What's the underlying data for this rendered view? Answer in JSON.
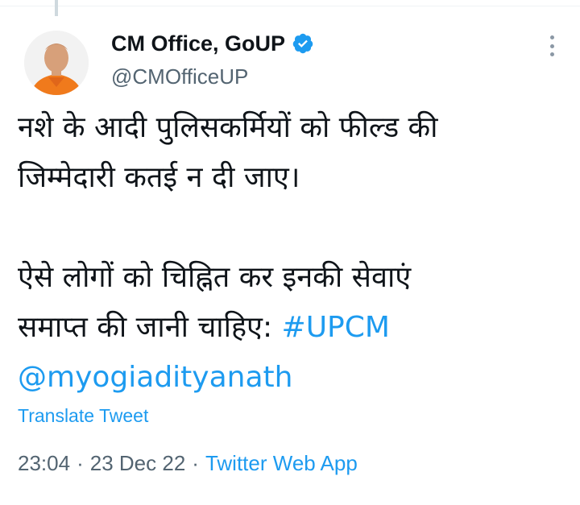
{
  "tweet": {
    "author": {
      "display_name": "CM Office, GoUP",
      "handle": "@CMOfficeUP",
      "verified": true
    },
    "text_lines": [
      "नशे के आदी पुलिसकर्मियों को फील्ड की",
      "जिम्मेदारी कतई न दी जाए।",
      "",
      "ऐसे लोगों को चिह्नित कर इनकी सेवाएं",
      "समाप्त की जानी चाहिए: "
    ],
    "hashtag": "#UPCM",
    "mention": "@myogiadityanath",
    "translate_label": "Translate Tweet",
    "time": "23:04",
    "date": "23 Dec 22",
    "separator": "·",
    "source": "Twitter Web App"
  },
  "colors": {
    "link": "#1d9bf0",
    "secondary_text": "#536471",
    "primary_text": "#0f1419"
  },
  "icons": {
    "verified": "verified-badge-icon",
    "more": "more-options-icon"
  }
}
